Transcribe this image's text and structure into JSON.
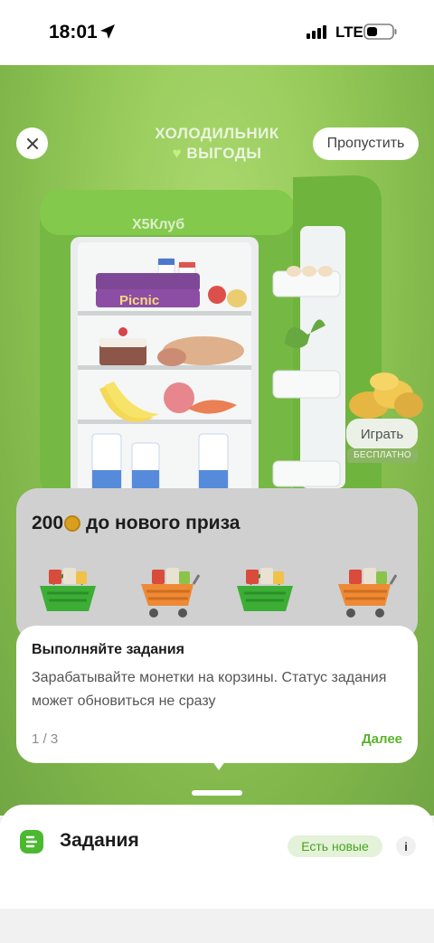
{
  "status_bar": {
    "time": "18:01",
    "network": "LTE"
  },
  "game": {
    "title_line1": "ХОЛОДИЛЬНИК",
    "title_heart": "♥",
    "title_line2": "ВЫГОДЫ",
    "skip_label": "Пропустить",
    "fridge_brand": "X5Клуб",
    "play_label": "Играть",
    "free_label": "БЕСПЛАТНО",
    "product_label": "Picnic"
  },
  "prize": {
    "amount": "200",
    "text": "до нового приза",
    "items": [
      {
        "icon": "green-basket-icon"
      },
      {
        "icon": "orange-cart-icon"
      },
      {
        "icon": "green-basket-icon"
      },
      {
        "icon": "orange-cart-icon"
      }
    ]
  },
  "tooltip": {
    "title": "Выполняйте задания",
    "text": "Зарабатывайте монетки на корзины. Статус задания может обновиться не сразу",
    "step": "1 / 3",
    "next_label": "Далее"
  },
  "bottom_sheet": {
    "title": "Задания",
    "badge": "Есть новые",
    "info_label": "i"
  },
  "colors": {
    "accent_green": "#5bb32c",
    "background_green": "#84c13e",
    "coin_gold": "#d9a020"
  }
}
